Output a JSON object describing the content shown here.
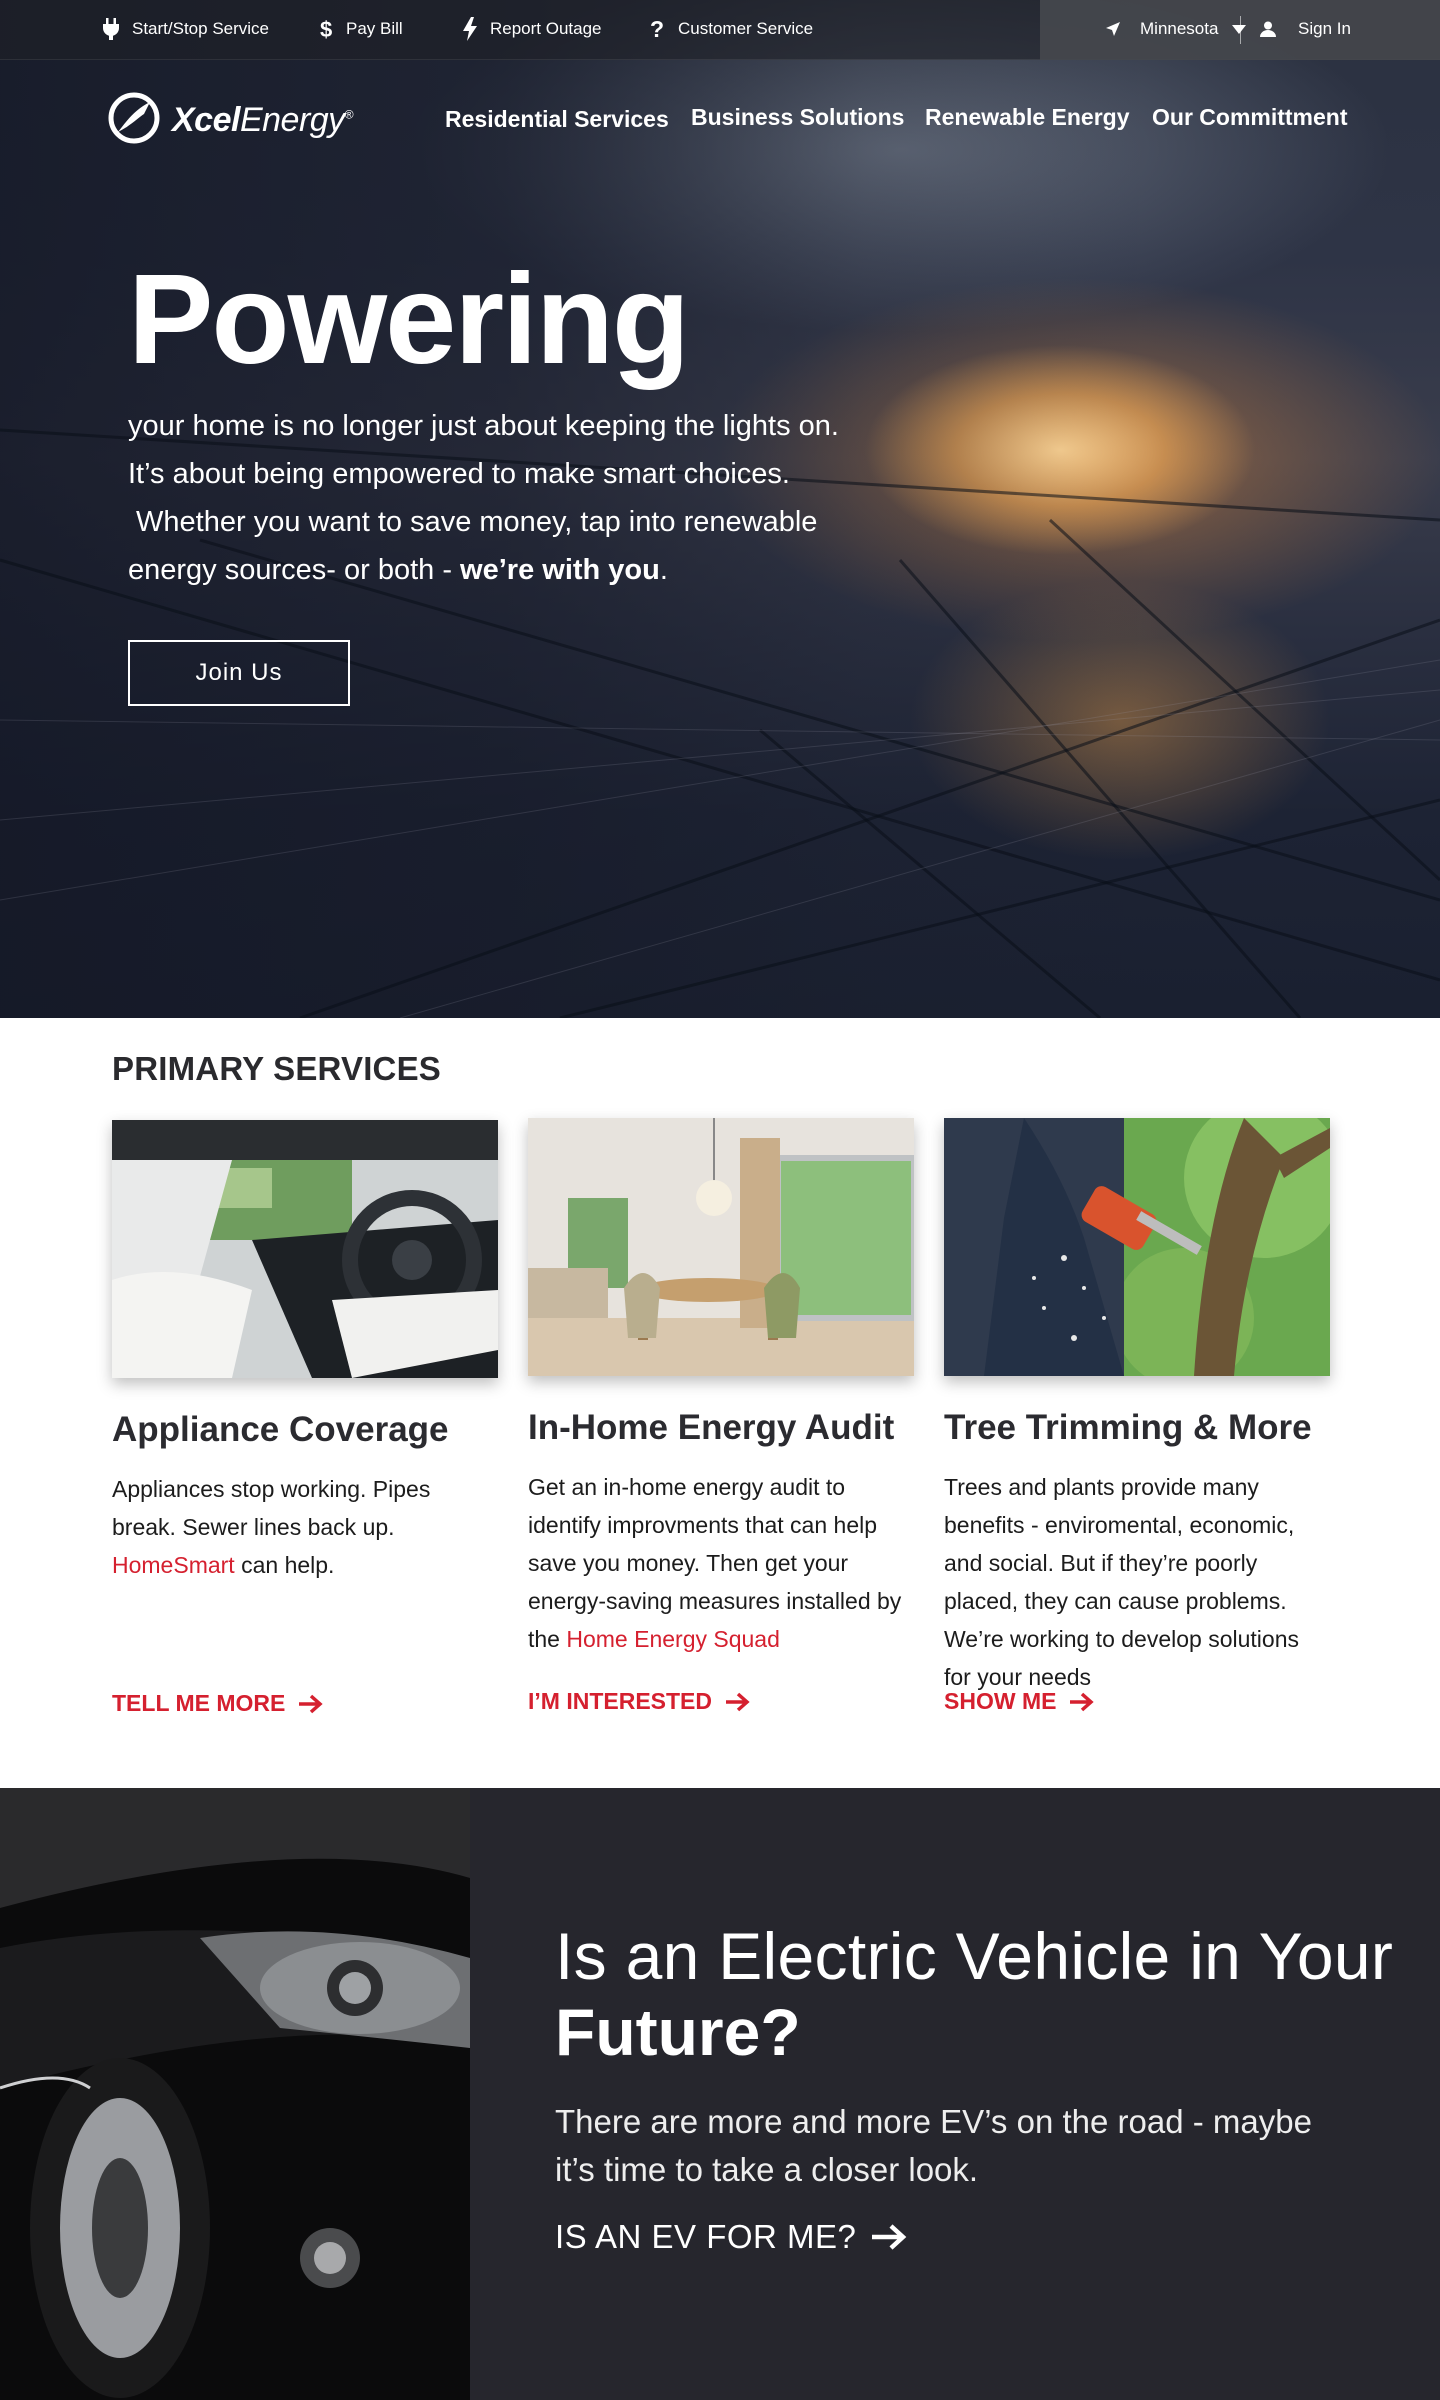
{
  "utility": {
    "start_stop": "Start/Stop Service",
    "pay_bill": "Pay Bill",
    "report_outage": "Report Outage",
    "customer_service": "Customer Service",
    "state": "Minnesota",
    "sign_in": "Sign In"
  },
  "brand": {
    "name_bold": "Xcel",
    "name_light": "Energy",
    "registered": "®"
  },
  "nav": [
    "Residential Services",
    "Business Solutions",
    "Renewable Energy",
    "Our Committment"
  ],
  "hero": {
    "title": "Powering",
    "line1": "your home is no longer just about keeping the lights on.",
    "line2": "It’s about being empowered to make smart choices.",
    "line3": " Whether you want to save money, tap into renewable",
    "line4_a": "energy sources- or both - ",
    "line4_b": "we’re with you",
    "line4_c": ".",
    "cta": "Join Us"
  },
  "services": {
    "heading": "PRIMARY SERVICES",
    "cards": [
      {
        "title": "Appliance Coverage",
        "text_a": "Appliances stop working. Pipes break. Sewer lines back up. ",
        "link_inline": "HomeSmart",
        "text_b": " can help.",
        "cta": "TELL ME MORE"
      },
      {
        "title": "In-Home Energy Audit",
        "text_a": "Get an in-home energy audit to identify improvments that can help save you money. Then get your energy-saving measures installed by the ",
        "link_inline": "Home Energy Squad",
        "text_b": "",
        "cta": "I’M INTERESTED"
      },
      {
        "title": "Tree Trimming & More",
        "text_a": "Trees and plants provide many benefits - enviromental, economic, and social. But if they’re poorly placed,  they can cause problems. We’re working to develop solutions for your  needs",
        "link_inline": "",
        "text_b": "",
        "cta": "SHOW ME"
      }
    ]
  },
  "ev": {
    "title_light": "Is an Electric Vehicle in Your",
    "title_bold": "Future?",
    "body": "There are more and more EV’s on the road - maybe it’s time to take a closer look.",
    "cta": "IS AN EV FOR ME?"
  },
  "colors": {
    "accent_red": "#d5202f",
    "dark_band": "#26262d",
    "utility_bar": "#1e2026"
  },
  "icons": [
    "plug-icon",
    "dollar-icon",
    "lightning-icon",
    "question-icon",
    "location-arrow-icon",
    "caret-down-icon",
    "user-icon",
    "arrow-right-icon",
    "xcel-swoosh-logo"
  ]
}
